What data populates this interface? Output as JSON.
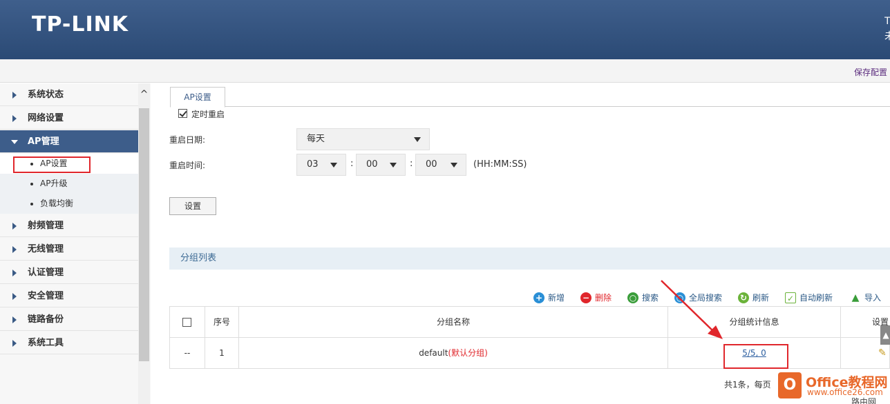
{
  "header": {
    "logo": "TP-LINK",
    "right_text_1": "T",
    "right_text_2": "未"
  },
  "savebar": {
    "save_config": "保存配置"
  },
  "sidebar": {
    "items": [
      {
        "label": "系统状态"
      },
      {
        "label": "网络设置"
      },
      {
        "label": "AP管理"
      },
      {
        "label": "射频管理"
      },
      {
        "label": "无线管理"
      },
      {
        "label": "认证管理"
      },
      {
        "label": "安全管理"
      },
      {
        "label": "链路备份"
      },
      {
        "label": "系统工具"
      }
    ],
    "subitems": [
      {
        "label": "AP设置"
      },
      {
        "label": "AP升级"
      },
      {
        "label": "负载均衡"
      }
    ],
    "scroll_up": "^"
  },
  "main": {
    "tab": "AP设置",
    "timed_reboot_label": "定时重启",
    "reboot_date_label": "重启日期:",
    "reboot_date_value": "每天",
    "reboot_time_label": "重启时间:",
    "hour": "03",
    "minute": "00",
    "second": "00",
    "time_sep": ":",
    "time_format": "(HH:MM:SS)",
    "set_button": "设置",
    "group_list_title": "分组列表"
  },
  "toolbar": {
    "add": "新增",
    "delete": "删除",
    "search": "搜索",
    "global_search": "全局搜索",
    "refresh": "刷新",
    "auto_refresh": "自动刷新",
    "import": "导入"
  },
  "table": {
    "headers": {
      "index": "序号",
      "name": "分组名称",
      "stats": "分组统计信息",
      "settings": "设置"
    },
    "rows": [
      {
        "select": "--",
        "index": "1",
        "name": "default",
        "name_suffix": "(默认分组)",
        "stats": "5/5, 0"
      }
    ]
  },
  "footer": {
    "summary": "共1条，每页"
  },
  "watermark": {
    "logo_letter": "O",
    "brand": "Office教程网",
    "url": "www.office26.com",
    "side": "路由网"
  },
  "colors": {
    "header": "#2b4a75",
    "active_nav": "#3d5d8a",
    "annotation": "#e0262b"
  }
}
